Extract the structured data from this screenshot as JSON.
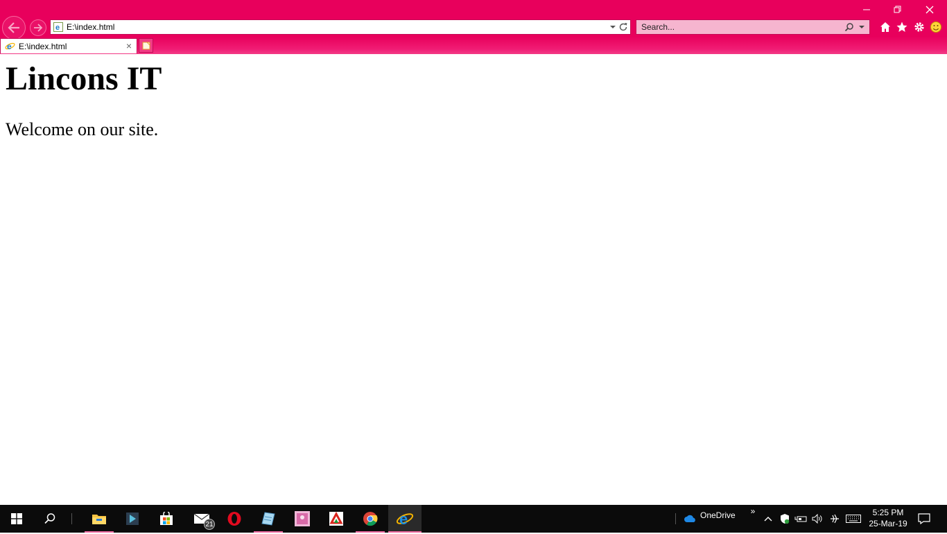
{
  "browser": {
    "address": "E:\\index.html",
    "search_placeholder": "Search...",
    "tab_title": "E:\\index.html",
    "tab_close": "×",
    "accent_color": "#e8005c"
  },
  "page": {
    "heading": "Lincons IT",
    "paragraph": "Welcome on our site."
  },
  "taskbar": {
    "mail_badge": "21",
    "onedrive_label": "OneDrive",
    "overflow": "»",
    "time": "5:25 PM",
    "date": "25-Mar-19"
  },
  "icons": {
    "window": [
      "minimize-icon",
      "restore-icon",
      "close-icon"
    ],
    "toolbar": [
      "home-icon",
      "favorites-star-icon",
      "settings-gear-icon",
      "smiley-feedback-icon"
    ],
    "taskbar_apps": [
      "start-windows-icon",
      "search-icon",
      "file-explorer-icon",
      "app-icon",
      "store-icon",
      "mail-icon",
      "opera-icon",
      "notepad-icon",
      "photo-app-icon",
      "wps-icon",
      "chrome-icon",
      "internet-explorer-icon"
    ],
    "tray": [
      "onedrive-icon",
      "chevron-up-icon",
      "defender-shield-icon",
      "battery-icon",
      "volume-icon",
      "network-icon",
      "keyboard-icon",
      "notifications-icon"
    ]
  }
}
